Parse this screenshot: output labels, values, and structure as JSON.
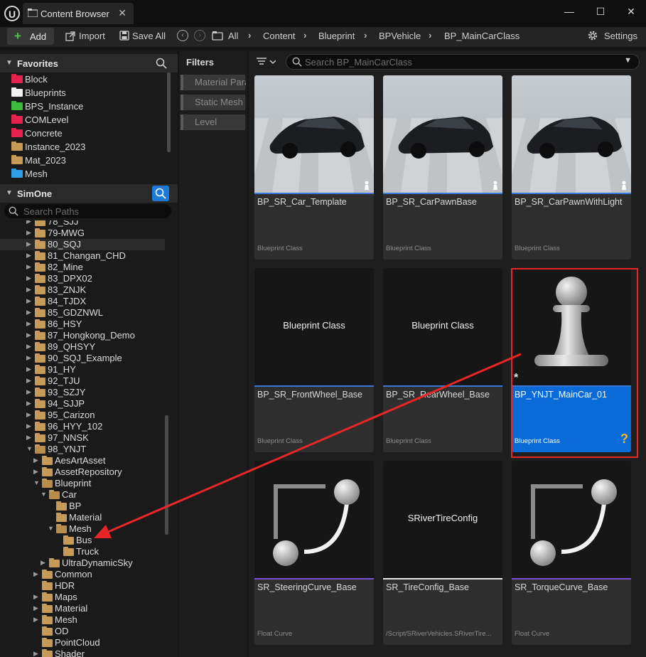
{
  "titlebar": {
    "tab_title": "Content Browser",
    "close": "✕",
    "minimize": "—",
    "maximize": "☐",
    "window_close": "✕"
  },
  "toolbar": {
    "add_label": "Add",
    "import_label": "Import",
    "save_all_label": "Save All",
    "breadcrumbs": [
      "All",
      "Content",
      "Blueprint",
      "BPVehicle",
      "BP_MainCarClass"
    ],
    "settings_label": "Settings"
  },
  "favorites": {
    "title": "Favorites",
    "items": [
      {
        "label": "Block",
        "color": "#e8224e"
      },
      {
        "label": "Blueprints",
        "color": "#f2f2f2"
      },
      {
        "label": "BPS_Instance",
        "color": "#3dbb3d"
      },
      {
        "label": "COMLevel",
        "color": "#e8224e"
      },
      {
        "label": "Concrete",
        "color": "#e8224e"
      },
      {
        "label": "Instance_2023",
        "color": "#c79a58"
      },
      {
        "label": "Mat_2023",
        "color": "#c79a58"
      },
      {
        "label": "Mesh",
        "color": "#2f9ce8"
      }
    ]
  },
  "simone": {
    "title": "SimOne",
    "search_placeholder": "Search Paths",
    "tree": [
      {
        "label": "78_SJJ",
        "indent": 0,
        "tw": "▶"
      },
      {
        "label": "79-MWG",
        "indent": 0,
        "tw": "▶"
      },
      {
        "label": "80_SQJ",
        "indent": 0,
        "tw": "▶",
        "sel": true
      },
      {
        "label": "81_Changan_CHD",
        "indent": 0,
        "tw": "▶"
      },
      {
        "label": "82_Mine",
        "indent": 0,
        "tw": "▶"
      },
      {
        "label": "83_DPX02",
        "indent": 0,
        "tw": "▶"
      },
      {
        "label": "83_ZNJK",
        "indent": 0,
        "tw": "▶"
      },
      {
        "label": "84_TJDX",
        "indent": 0,
        "tw": "▶"
      },
      {
        "label": "85_GDZNWL",
        "indent": 0,
        "tw": "▶"
      },
      {
        "label": "86_HSY",
        "indent": 0,
        "tw": "▶"
      },
      {
        "label": "87_Hongkong_Demo",
        "indent": 0,
        "tw": "▶"
      },
      {
        "label": "89_QHSYY",
        "indent": 0,
        "tw": "▶"
      },
      {
        "label": "90_SQJ_Example",
        "indent": 0,
        "tw": "▶"
      },
      {
        "label": "91_HY",
        "indent": 0,
        "tw": "▶"
      },
      {
        "label": "92_TJU",
        "indent": 0,
        "tw": "▶"
      },
      {
        "label": "93_SZJY",
        "indent": 0,
        "tw": "▶"
      },
      {
        "label": "94_SJJP",
        "indent": 0,
        "tw": "▶"
      },
      {
        "label": "95_Carizon",
        "indent": 0,
        "tw": "▶"
      },
      {
        "label": "96_HYY_102",
        "indent": 0,
        "tw": "▶"
      },
      {
        "label": "97_NNSK",
        "indent": 0,
        "tw": "▶"
      },
      {
        "label": "98_YNJT",
        "indent": 0,
        "tw": "▼",
        "open": true
      },
      {
        "label": "AesArtAsset",
        "indent": 1,
        "tw": "▶"
      },
      {
        "label": "AssetRepository",
        "indent": 1,
        "tw": "▶"
      },
      {
        "label": "Blueprint",
        "indent": 1,
        "tw": "▼",
        "open": true
      },
      {
        "label": "Car",
        "indent": 2,
        "tw": "▼",
        "open": true
      },
      {
        "label": "BP",
        "indent": 3,
        "tw": ""
      },
      {
        "label": "Material",
        "indent": 3,
        "tw": ""
      },
      {
        "label": "Mesh",
        "indent": 3,
        "tw": "▼",
        "open": true
      },
      {
        "label": "Bus",
        "indent": 4,
        "tw": ""
      },
      {
        "label": "Truck",
        "indent": 4,
        "tw": ""
      },
      {
        "label": "UltraDynamicSky",
        "indent": 2,
        "tw": "▶"
      },
      {
        "label": "Common",
        "indent": 1,
        "tw": "▶"
      },
      {
        "label": "HDR",
        "indent": 1,
        "tw": ""
      },
      {
        "label": "Maps",
        "indent": 1,
        "tw": "▶"
      },
      {
        "label": "Material",
        "indent": 1,
        "tw": "▶"
      },
      {
        "label": "Mesh",
        "indent": 1,
        "tw": "▶"
      },
      {
        "label": "OD",
        "indent": 1,
        "tw": ""
      },
      {
        "label": "PointCloud",
        "indent": 1,
        "tw": ""
      },
      {
        "label": "Shader",
        "indent": 1,
        "tw": "▶"
      }
    ]
  },
  "filters": {
    "title": "Filters",
    "chips": [
      "Material Parameter Collection",
      "Static Mesh",
      "Level"
    ]
  },
  "content": {
    "search_placeholder": "Search BP_MainCarClass",
    "assets": [
      {
        "name": "BP_SR_Car_Template",
        "class": "Blueprint Class",
        "thumb": "car",
        "bar": "#3a78d8"
      },
      {
        "name": "BP_SR_CarPawnBase",
        "class": "Blueprint Class",
        "thumb": "car",
        "bar": "#3a78d8"
      },
      {
        "name": "BP_SR_CarPawnWithLight",
        "class": "Blueprint Class",
        "thumb": "car",
        "bar": "#3a78d8"
      },
      {
        "name": "BP_SR_FrontWheel_Base",
        "class": "Blueprint Class",
        "thumb": "text",
        "thumb_text": "Blueprint Class",
        "bar": "#3a78d8"
      },
      {
        "name": "BP_SR_RearWheel_Base",
        "class": "Blueprint Class",
        "thumb": "text",
        "thumb_text": "Blueprint Class",
        "bar": "#3a78d8"
      },
      {
        "name": "BP_YNJT_MainCar_01",
        "class": "Blueprint Class",
        "thumb": "pawn",
        "bar": "#3a78d8",
        "selected": true
      },
      {
        "name": "SR_SteeringCurve_Base",
        "class": "Float Curve",
        "thumb": "curve",
        "bar": "#7a4fd8"
      },
      {
        "name": "SR_TireConfig_Base",
        "class": "/Script/SRiverVehicles.SRiverTire...",
        "thumb": "text",
        "thumb_text": "SRiverTireConfig",
        "bar": "#e8e8e8"
      },
      {
        "name": "SR_TorqueCurve_Base",
        "class": "Float Curve",
        "thumb": "curve",
        "bar": "#7a4fd8"
      }
    ],
    "unsaved_marker": "*",
    "unknown_marker": "?"
  },
  "colors": {
    "accent": "#0a6ad8",
    "annotation": "#e82626"
  }
}
